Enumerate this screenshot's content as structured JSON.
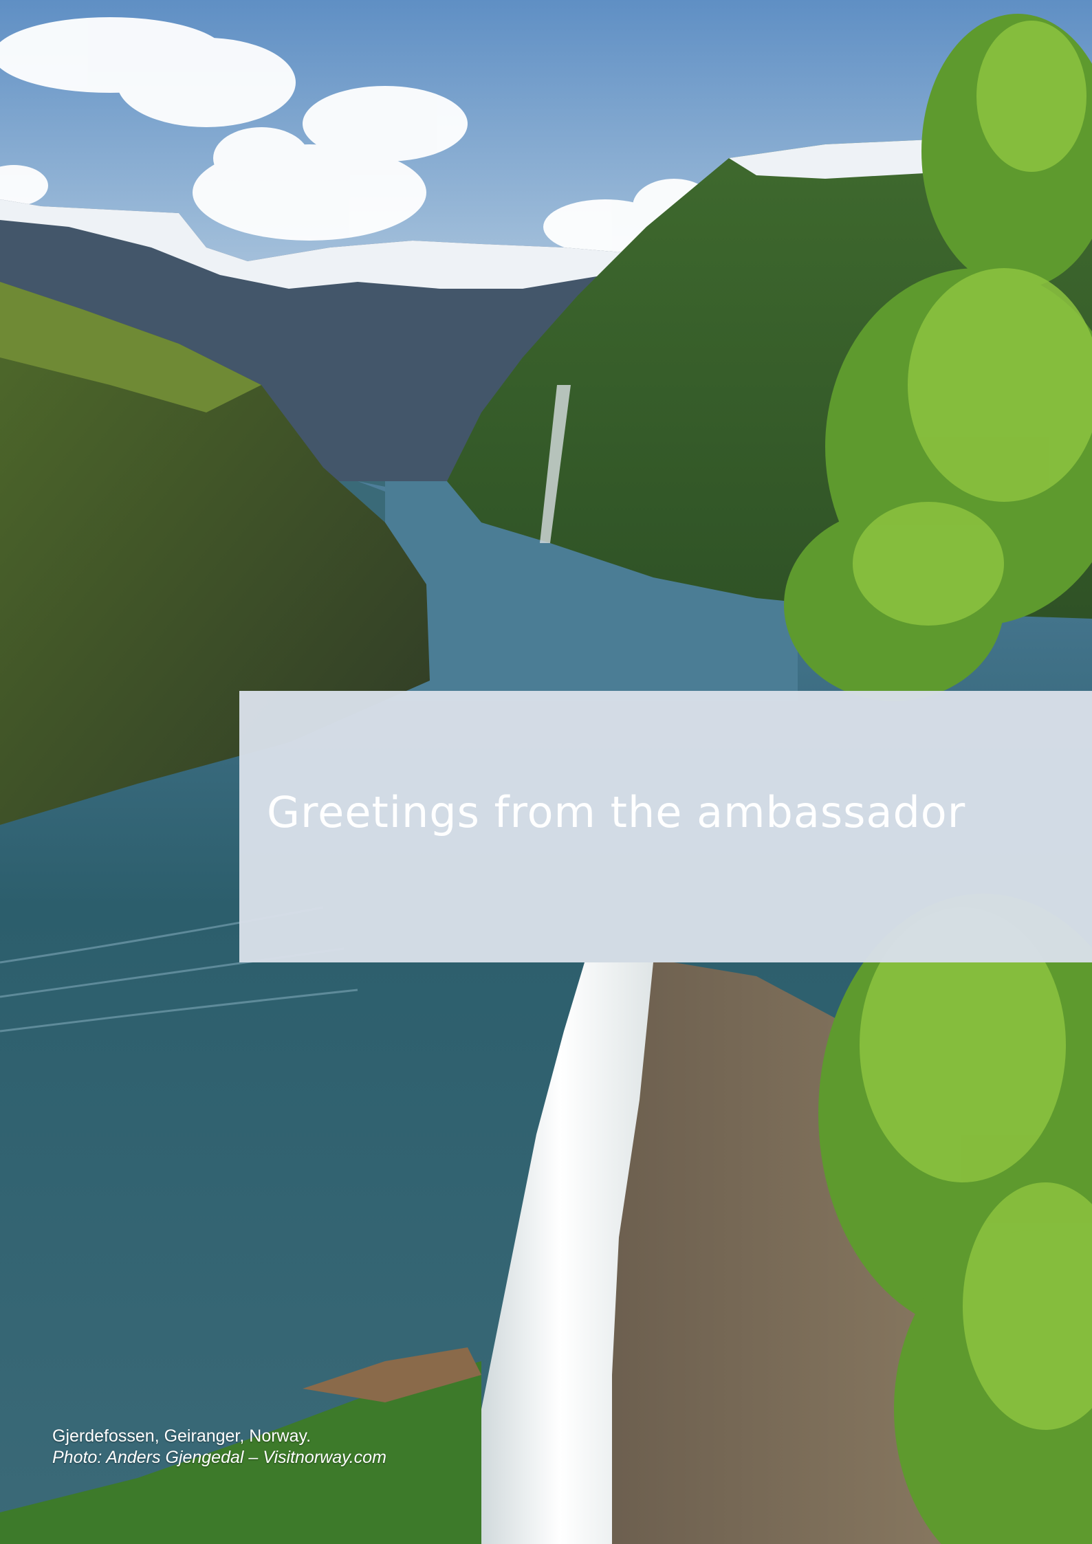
{
  "page": {
    "title": "Greetings from the ambassador"
  },
  "photo": {
    "caption": "Gjerdefossen, Geiranger, Norway.",
    "credit": "Photo: Anders Gjengedal – Visitnorway.com"
  },
  "colors": {
    "panel": "#d8dfe8",
    "title_text": "#ffffff"
  }
}
